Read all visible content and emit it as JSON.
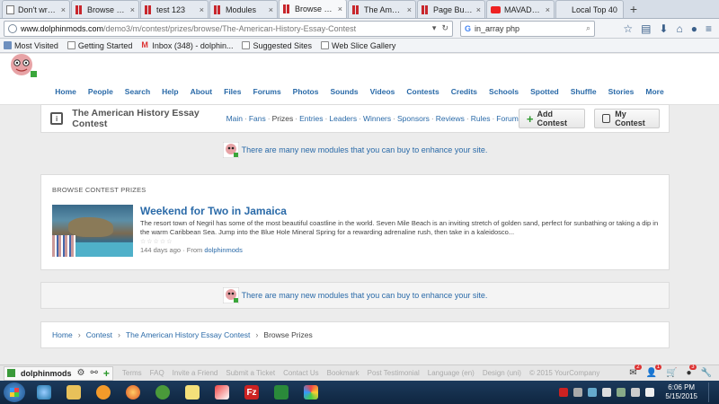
{
  "browser": {
    "tabs": [
      {
        "label": "Don't wreck r...",
        "icon": "doc",
        "active": false
      },
      {
        "label": "Browse Entrie...",
        "icon": "db",
        "active": false
      },
      {
        "label": "test 123",
        "icon": "db",
        "active": false
      },
      {
        "label": "Modules",
        "icon": "db",
        "active": false
      },
      {
        "label": "Browse Pr...",
        "icon": "db",
        "active": true
      },
      {
        "label": "The America...",
        "icon": "db",
        "active": false
      },
      {
        "label": "Page Builder",
        "icon": "db",
        "active": false
      },
      {
        "label": "MAVADO - I...",
        "icon": "yt",
        "active": false
      },
      {
        "label": "Local Top 40",
        "icon": "blank",
        "active": false
      }
    ],
    "url_host": "www.dolphinmods.com",
    "url_path": "/demo3/m/contest/prizes/browse/The-American-History-Essay-Contest",
    "search_value": "in_array php",
    "bookmarks": [
      "Most Visited",
      "Getting Started",
      "Inbox (348) - dolphin...",
      "Suggested Sites",
      "Web Slice Gallery"
    ]
  },
  "site": {
    "menu": [
      "Home",
      "People",
      "Search",
      "Help",
      "About",
      "Files",
      "Forums",
      "Photos",
      "Sounds",
      "Videos",
      "Contests",
      "Credits",
      "Schools",
      "Spotted",
      "Shuffle",
      "Stories",
      "More"
    ],
    "contest": {
      "title": "The American History Essay Contest",
      "sublinks": [
        "Main",
        "Fans",
        "Prizes",
        "Entries",
        "Leaders",
        "Winners",
        "Sponsors",
        "Reviews",
        "Rules",
        "Forum"
      ],
      "current_sublink": "Prizes",
      "add_button": "Add Contest",
      "my_button": "My Contest"
    },
    "notice": "There are many new modules that you can buy to enhance your site.",
    "prizes": {
      "heading": "BROWSE CONTEST PRIZES",
      "items": [
        {
          "title": "Weekend for Two in Jamaica",
          "description": "The resort town of Negril has some of the most beautiful coastline in the world. Seven Mile Beach is an inviting stretch of golden sand, perfect for sunbathing or taking a dip in the warm Caribbean Sea. Jump into the Blue Hole Mineral Spring for a rewarding adrenaline rush, then take in a kaleidosco...",
          "stars": "☆☆☆☆☆",
          "age": "144 days ago",
          "from_label": "From",
          "author": "dolphinmods"
        }
      ]
    },
    "breadcrumb": [
      "Home",
      "Contest",
      "The American History Essay Contest",
      "Browse Prizes"
    ],
    "footer_links": [
      "Terms",
      "FAQ",
      "Invite a Friend",
      "Submit a Ticket",
      "Contact Us",
      "Bookmark",
      "Post Testimonial",
      "Language (en)",
      "Design (uni)",
      "© 2015 YourCompany"
    ],
    "dock_user": "dolphinmods",
    "badges": {
      "mail": "2",
      "friends": "1",
      "notify": "3"
    }
  },
  "taskbar": {
    "time": "6:06 PM",
    "date": "5/15/2015"
  }
}
